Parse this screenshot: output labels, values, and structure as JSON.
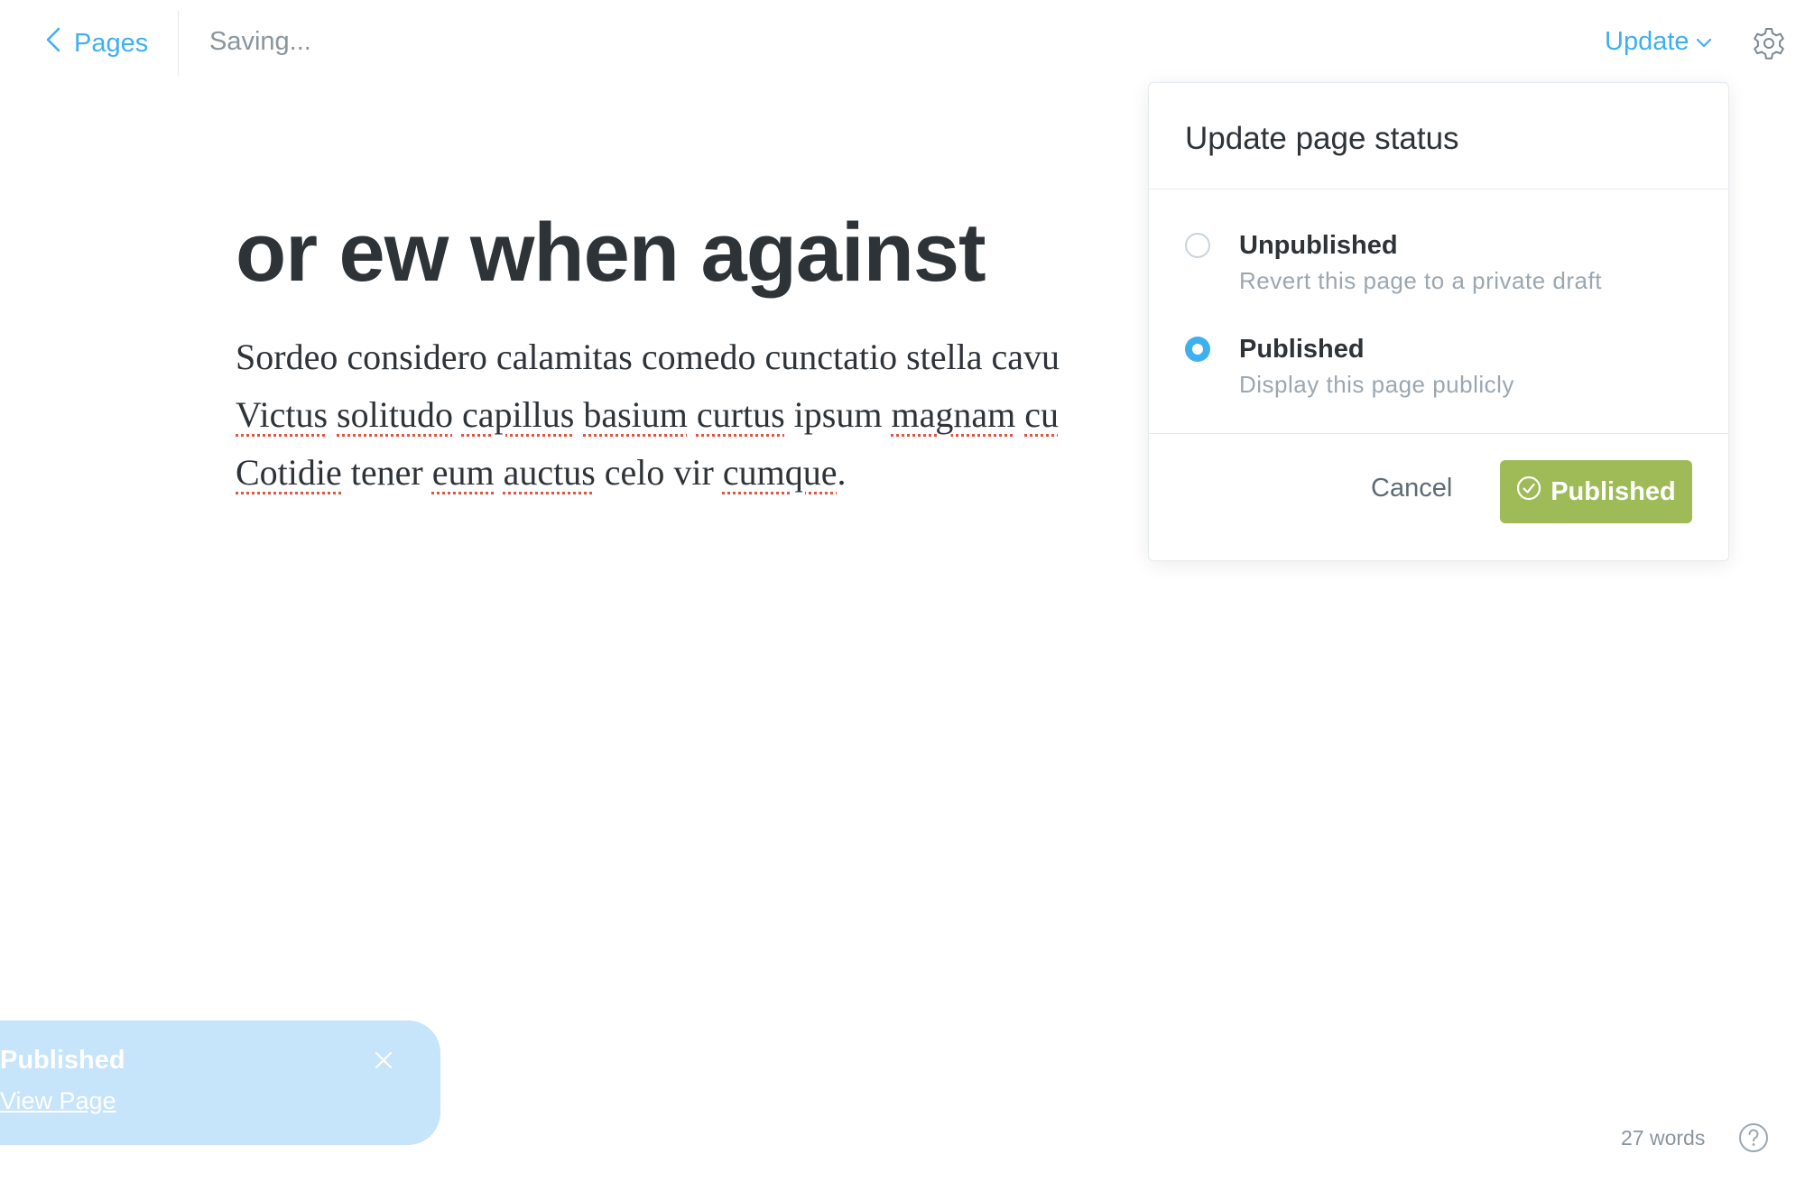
{
  "header": {
    "back_label": "Pages",
    "save_status": "Saving...",
    "update_label": "Update"
  },
  "editor": {
    "title": "or ew when against",
    "body_lines": [
      [
        "Sordeo considero calamitas comedo cunctatio stella cavu"
      ],
      [
        "Victus",
        "solitudo",
        "capillus",
        "basium",
        "curtus",
        "ipsum",
        "magnam",
        "cu"
      ],
      [
        "Cotidie",
        "tener",
        "eum",
        "auctus",
        "celo vir",
        "cumque",
        "."
      ]
    ]
  },
  "popover": {
    "title": "Update page status",
    "options": [
      {
        "label": "Unpublished",
        "description": "Revert this page to a private draft",
        "selected": false
      },
      {
        "label": "Published",
        "description": "Display this page publicly",
        "selected": true
      }
    ],
    "cancel_label": "Cancel",
    "confirm_label": "Published",
    "confirm_color": "#9fbb58",
    "accent_color": "#3eb0ef"
  },
  "toast": {
    "title": "Published",
    "link_label": "View Page",
    "background": "#c6e4fa"
  },
  "footer": {
    "word_count": "27 words"
  },
  "icons": {
    "back": "chevron-left-icon",
    "update": "chevron-down-icon",
    "settings": "gear-icon",
    "confirm": "check-circle-icon",
    "close": "close-icon",
    "help": "question-circle-icon"
  }
}
